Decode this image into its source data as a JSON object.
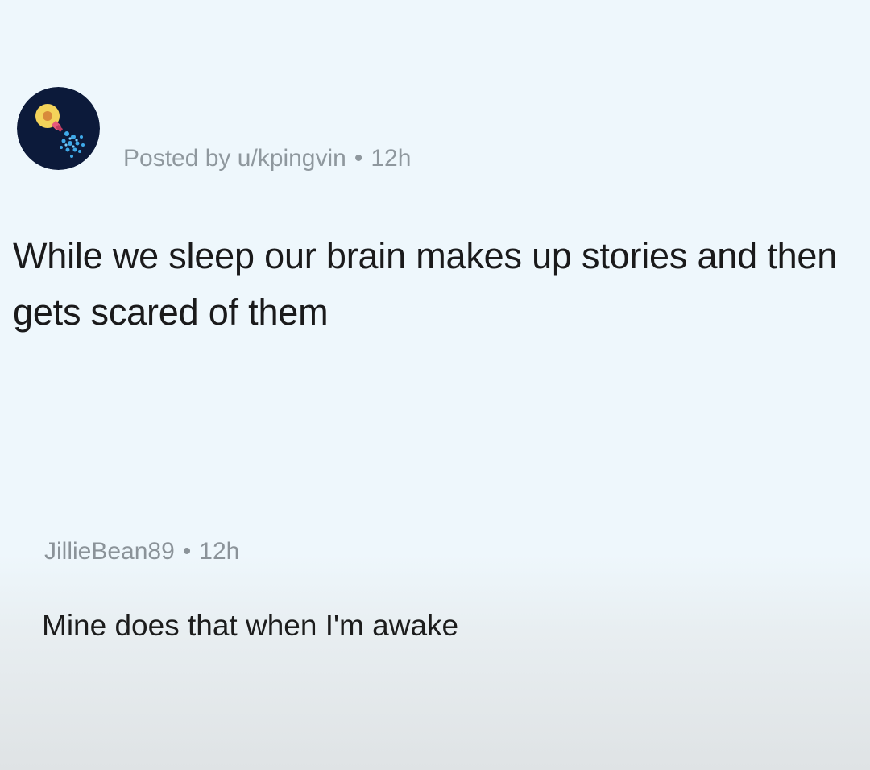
{
  "post": {
    "avatar_icon": "lightbulb-brain-icon",
    "posted_by": "Posted by u/kpingvin",
    "separator": "•",
    "time": "12h",
    "title": "While we sleep our brain makes up stories and then gets scared of them"
  },
  "comment": {
    "author": "JillieBean89",
    "separator": "•",
    "time": "12h",
    "text": "Mine does that when I'm awake"
  },
  "colors": {
    "background": "#eef7fc",
    "avatar_bg": "#0c1a3a",
    "bulb": "#f3d35a",
    "meta_text": "#8f989e",
    "title_text": "#1a1a1b"
  }
}
